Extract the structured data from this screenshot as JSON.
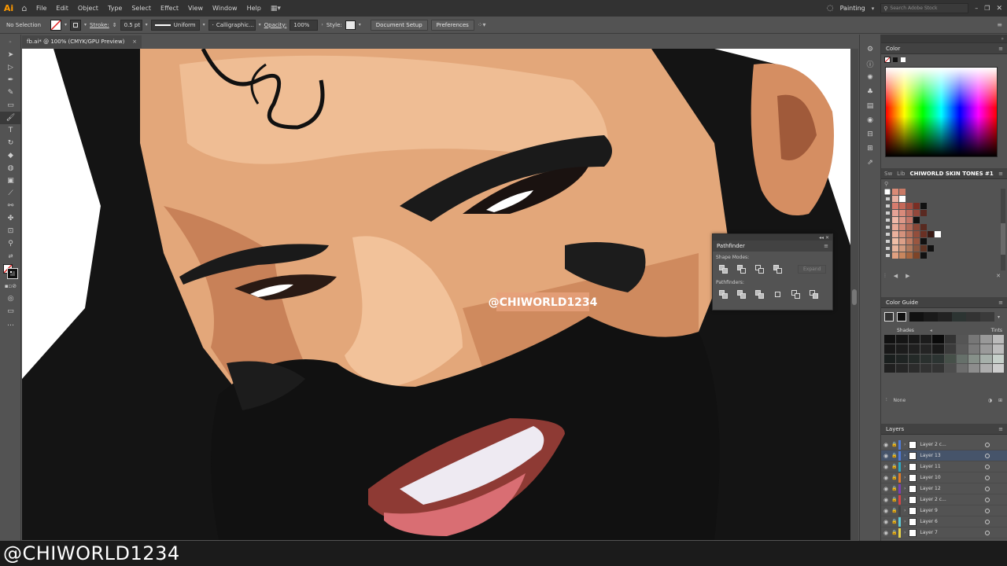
{
  "app": {
    "logo": "Ai",
    "workspace": "Painting",
    "search_placeholder": "Search Adobe Stock"
  },
  "menu": [
    "File",
    "Edit",
    "Object",
    "Type",
    "Select",
    "Effect",
    "View",
    "Window",
    "Help"
  ],
  "control": {
    "selection": "No Selection",
    "stroke_label": "Stroke:",
    "stroke_value": "0.5 pt",
    "profile": "Uniform",
    "brush": "Calligraphic...",
    "opacity_label": "Opacity:",
    "opacity_value": "100%",
    "style_label": "Style:",
    "doc_setup": "Document Setup",
    "preferences": "Preferences"
  },
  "document_tab": {
    "title": "fb.ai* @ 100% (CMYK/GPU Preview)",
    "close": "×"
  },
  "canvas": {
    "watermark_tag": "@CHIWORLD1234"
  },
  "pathfinder": {
    "title": "Pathfinder",
    "shape_modes": "Shape Modes:",
    "pathfinders": "Pathfinders:",
    "expand": "Expand"
  },
  "color_panel": {
    "title": "Color"
  },
  "swatches_panel": {
    "tab1": "Sw",
    "tab2": "Lib",
    "tab3": "CHIWORLD SKIN TONES #1"
  },
  "color_guide": {
    "title": "Color Guide",
    "shades": "Shades",
    "tints": "Tints",
    "none_label": "None"
  },
  "layers": {
    "title": "Layers",
    "items": [
      {
        "name": "Layer 2 c...",
        "color": "#4f7ad6"
      },
      {
        "name": "Layer 13",
        "color": "#4f7ad6"
      },
      {
        "name": "Layer 11",
        "color": "#2ea7c1"
      },
      {
        "name": "Layer 10",
        "color": "#e07b2b"
      },
      {
        "name": "Layer 12",
        "color": "#7a3fb0"
      },
      {
        "name": "Layer 2 c...",
        "color": "#d64545"
      },
      {
        "name": "Layer 9",
        "color": "#444444"
      },
      {
        "name": "Layer 6",
        "color": "#5fc9d6"
      },
      {
        "name": "Layer 7",
        "color": "#e6d24a"
      }
    ]
  },
  "footer": {
    "watermark": "@CHIWORLD1234"
  }
}
